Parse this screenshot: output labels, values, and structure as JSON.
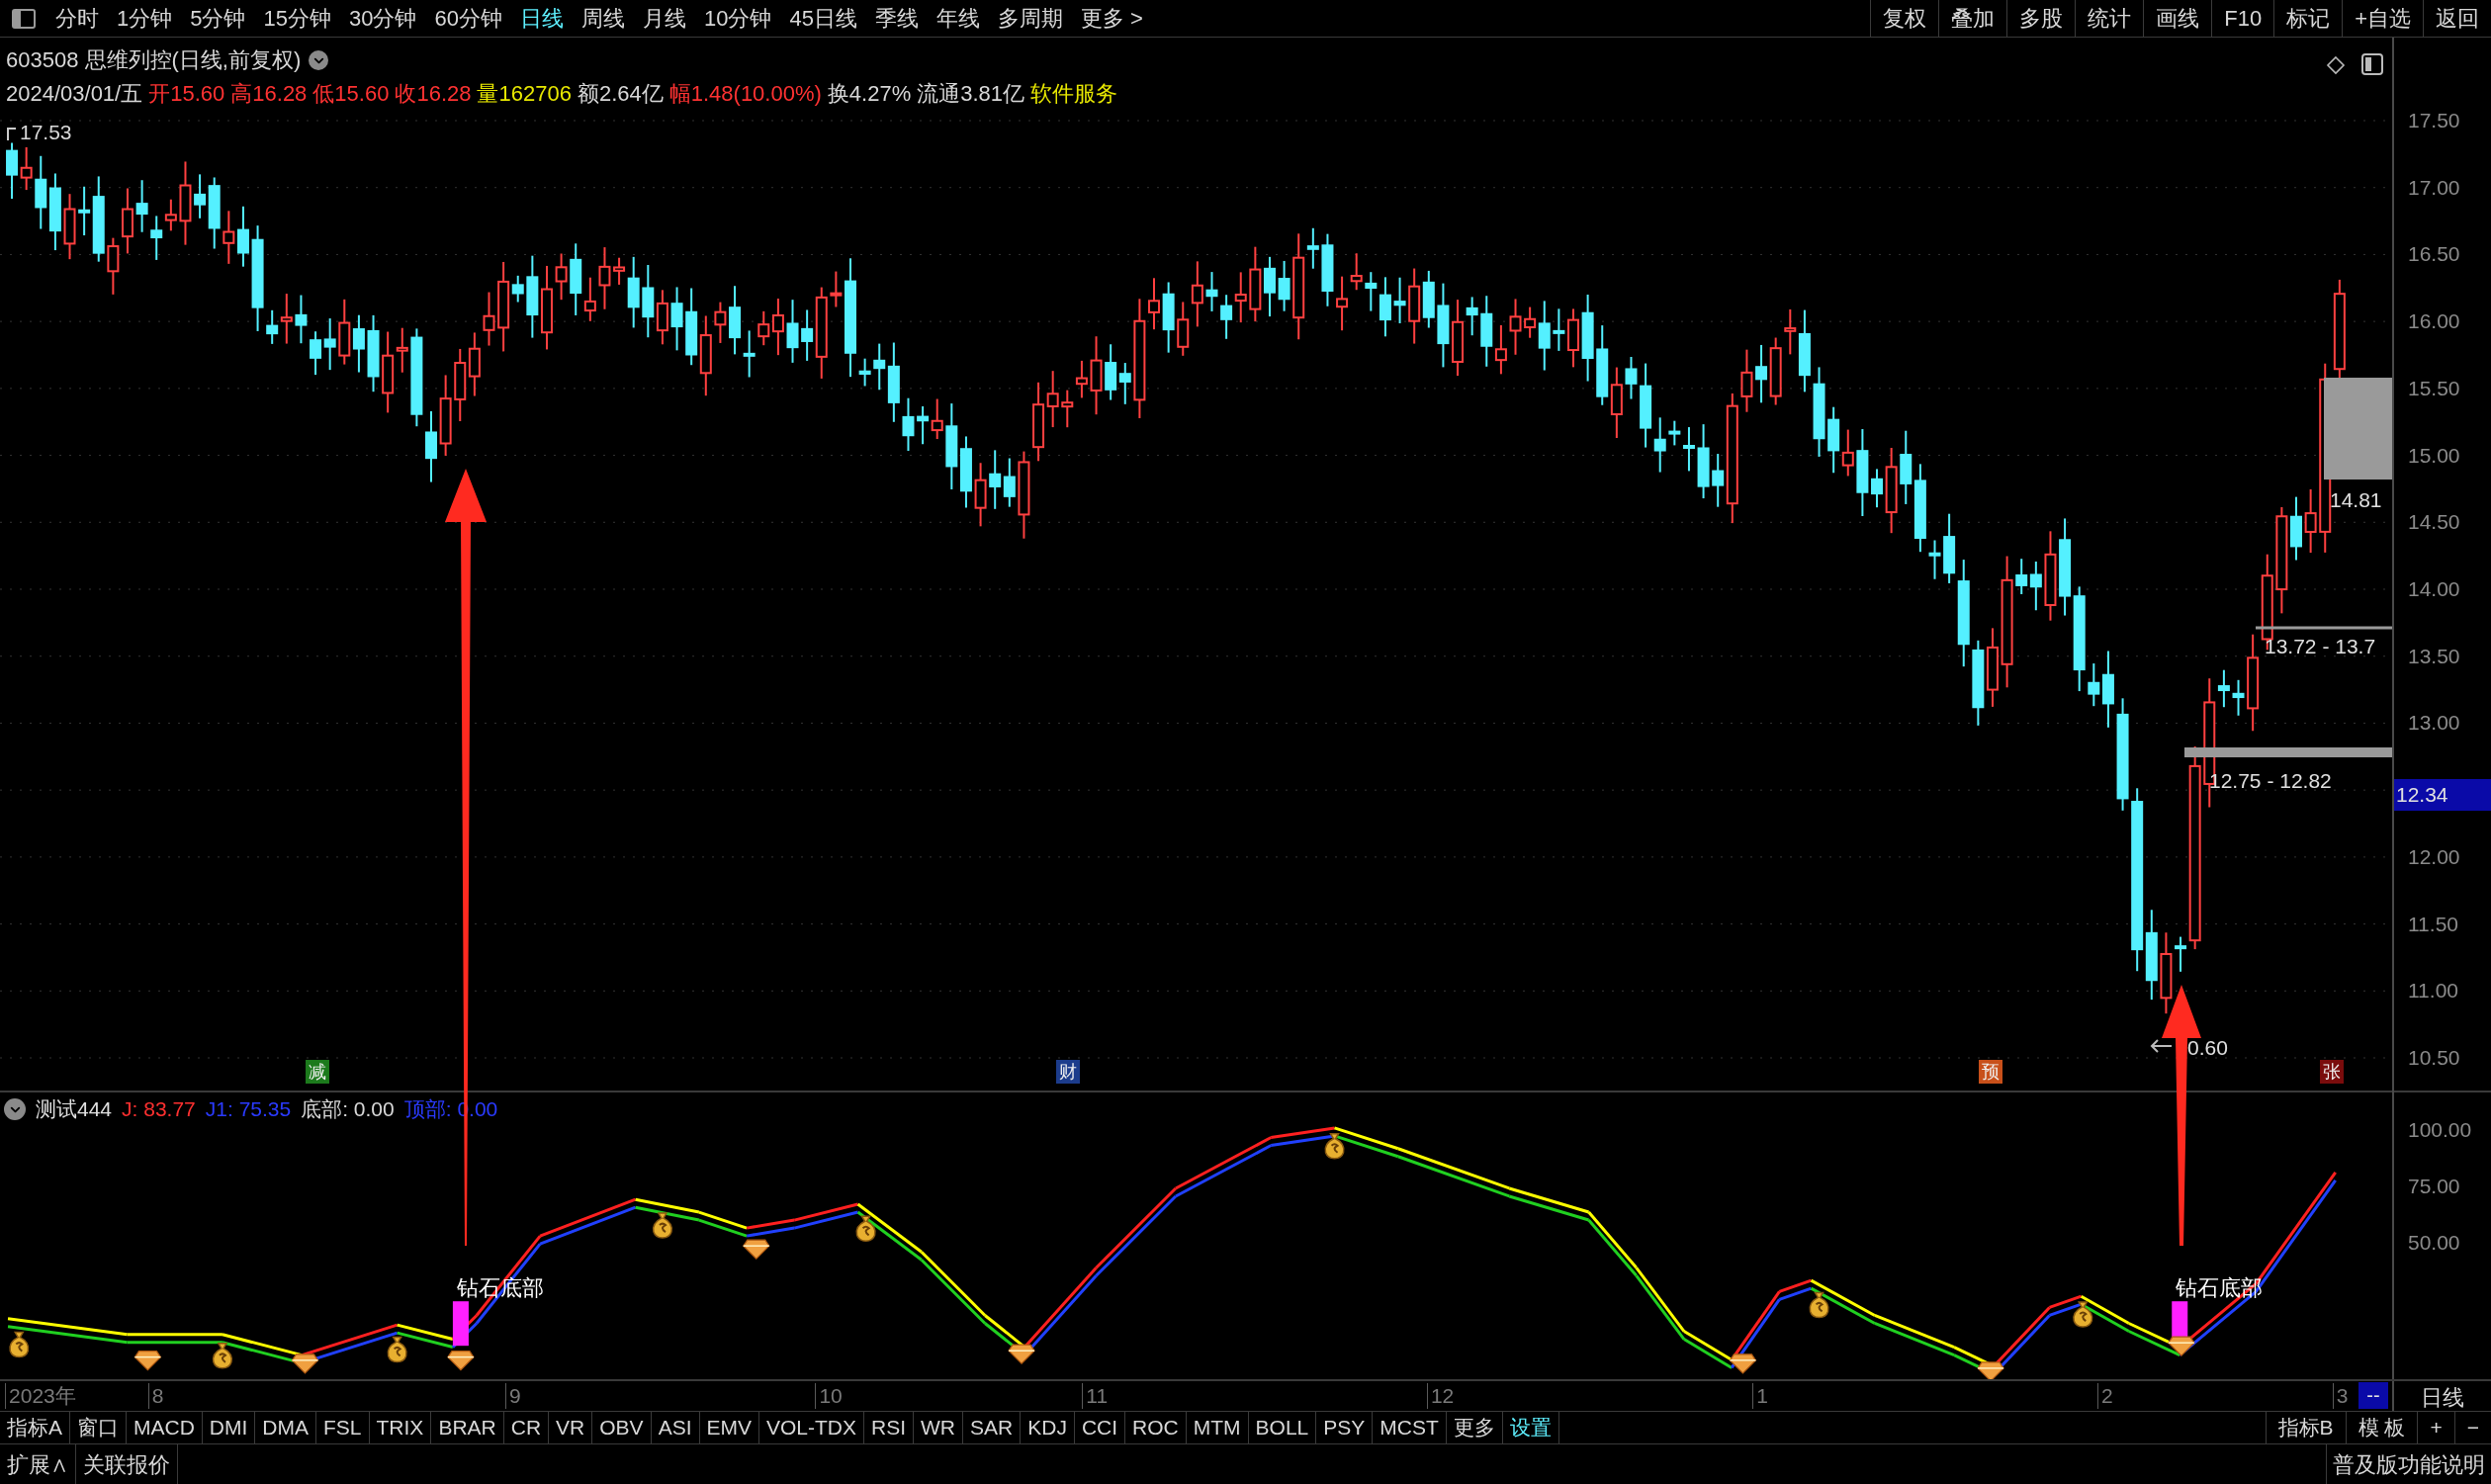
{
  "toolbar": {
    "periods": [
      {
        "label": "分时",
        "selected": false
      },
      {
        "label": "1分钟",
        "selected": false
      },
      {
        "label": "5分钟",
        "selected": false
      },
      {
        "label": "15分钟",
        "selected": false
      },
      {
        "label": "30分钟",
        "selected": false
      },
      {
        "label": "60分钟",
        "selected": false
      },
      {
        "label": "日线",
        "selected": true
      },
      {
        "label": "周线",
        "selected": false
      },
      {
        "label": "月线",
        "selected": false
      },
      {
        "label": "10分钟",
        "selected": false
      },
      {
        "label": "45日线",
        "selected": false
      },
      {
        "label": "季线",
        "selected": false
      },
      {
        "label": "年线",
        "selected": false
      },
      {
        "label": "多周期",
        "selected": false
      },
      {
        "label": "更多 >",
        "selected": false
      }
    ],
    "actions": [
      "复权",
      "叠加",
      "多股",
      "统计",
      "画线",
      "F10",
      "标记",
      "+自选",
      "返回"
    ]
  },
  "stock": {
    "title": "603508 思维列控(日线,前复权)",
    "quote": [
      {
        "text": "2024/03/01/五",
        "color": "#d8d8d8"
      },
      {
        "text": "开15.60",
        "color": "#ff3232"
      },
      {
        "text": "高16.28",
        "color": "#ff3232"
      },
      {
        "text": "低15.60",
        "color": "#ff3232"
      },
      {
        "text": "收16.28",
        "color": "#ff3232"
      },
      {
        "text": "量162706",
        "color": "#e8e800"
      },
      {
        "text": "额2.64亿",
        "color": "#d8d8d8"
      },
      {
        "text": "幅1.48(10.00%)",
        "color": "#ff3232"
      },
      {
        "text": "换4.27%",
        "color": "#d8d8d8"
      },
      {
        "text": "流通3.81亿",
        "color": "#d8d8d8"
      },
      {
        "text": "软件服务",
        "color": "#e8e800"
      }
    ]
  },
  "price_chart": {
    "axis_labels": [
      "17.50",
      "17.00",
      "16.50",
      "16.00",
      "15.50",
      "15.00",
      "14.50",
      "14.00",
      "13.50",
      "13.00",
      "12.00",
      "11.50",
      "11.00",
      "10.50"
    ],
    "current_price": "12.34",
    "high_label": "17.53",
    "low_label": "0.60",
    "zones": [
      {
        "label": "14.81"
      },
      {
        "label": "13.72 - 13.7"
      },
      {
        "label": "12.75 - 12.82"
      }
    ],
    "events": [
      {
        "label": "减",
        "color": "#1c7a1c"
      },
      {
        "label": "财",
        "color": "#1c3c8c"
      },
      {
        "label": "预",
        "color": "#c8501a"
      },
      {
        "label": "张",
        "color": "#7a0c0c"
      }
    ]
  },
  "indicator": {
    "name": "测试444",
    "values": [
      {
        "text": "J: 83.77",
        "color": "#ff3030"
      },
      {
        "text": "J1: 75.35",
        "color": "#2a3aff"
      },
      {
        "text": "底部: 0.00",
        "color": "#d8d8d8"
      },
      {
        "text": "顶部: 0.00",
        "color": "#2a3aff"
      }
    ],
    "axis_labels": [
      "100.00",
      "75.00",
      "50.00"
    ],
    "signals": [
      {
        "label": "钻石底部"
      },
      {
        "label": "钻石底部"
      }
    ]
  },
  "date_axis": {
    "labels": [
      "2023年",
      "8",
      "9",
      "10",
      "11",
      "12",
      "1",
      "2",
      "3"
    ],
    "tag": "--",
    "period": "日线"
  },
  "indicator_tabs": [
    {
      "label": "指标A",
      "accent": false
    },
    {
      "label": "窗口",
      "accent": false
    },
    {
      "label": "MACD",
      "accent": false
    },
    {
      "label": "DMI",
      "accent": false
    },
    {
      "label": "DMA",
      "accent": false
    },
    {
      "label": "FSL",
      "accent": false
    },
    {
      "label": "TRIX",
      "accent": false
    },
    {
      "label": "BRAR",
      "accent": false
    },
    {
      "label": "CR",
      "accent": false
    },
    {
      "label": "VR",
      "accent": false
    },
    {
      "label": "OBV",
      "accent": false
    },
    {
      "label": "ASI",
      "accent": false
    },
    {
      "label": "EMV",
      "accent": false
    },
    {
      "label": "VOL-TDX",
      "accent": false
    },
    {
      "label": "RSI",
      "accent": false
    },
    {
      "label": "WR",
      "accent": false
    },
    {
      "label": "SAR",
      "accent": false
    },
    {
      "label": "KDJ",
      "accent": false
    },
    {
      "label": "CCI",
      "accent": false
    },
    {
      "label": "ROC",
      "accent": false
    },
    {
      "label": "MTM",
      "accent": false
    },
    {
      "label": "BOLL",
      "accent": false
    },
    {
      "label": "PSY",
      "accent": false
    },
    {
      "label": "MCST",
      "accent": false
    },
    {
      "label": "更多",
      "accent": false
    },
    {
      "label": "设置",
      "accent": true
    }
  ],
  "right_tabs": [
    "指标B",
    "模 板",
    "+",
    "−"
  ],
  "status_bar": {
    "left": [
      "扩展∧",
      "关联报价"
    ],
    "right": "普及版功能说明"
  }
}
